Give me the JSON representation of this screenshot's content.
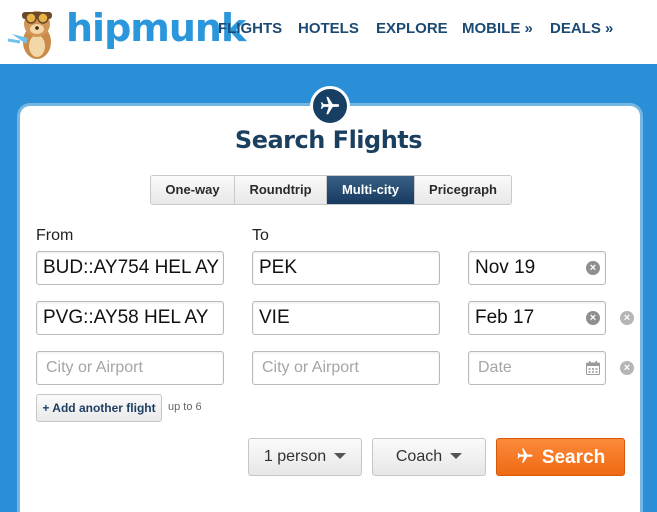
{
  "header": {
    "logo_text": "hipmunk",
    "nav": [
      "FLIGHTS",
      "HOTELS",
      "EXPLORE",
      "MOBILE »",
      "DEALS »"
    ]
  },
  "search": {
    "title": "Search Flights",
    "tabs": [
      {
        "label": "One-way",
        "active": false
      },
      {
        "label": "Roundtrip",
        "active": false
      },
      {
        "label": "Multi-city",
        "active": true
      },
      {
        "label": "Pricegraph",
        "active": false
      }
    ],
    "from_label": "From",
    "to_label": "To",
    "legs": [
      {
        "from": "BUD::AY754 HEL AY",
        "to": "PEK",
        "date": "Nov 19"
      },
      {
        "from": "PVG::AY58 HEL AY",
        "to": "VIE",
        "date": "Feb 17"
      }
    ],
    "empty_leg": {
      "from_placeholder": "City or Airport",
      "to_placeholder": "City or Airport",
      "date_placeholder": "Date"
    },
    "add_flight_label": "+ Add another flight",
    "add_flight_hint": "up to 6",
    "passengers": "1 person",
    "cabin": "Coach",
    "search_label": "Search"
  },
  "colors": {
    "brand_blue": "#2a96dc",
    "navy": "#173f64",
    "search_orange": "#f27420"
  }
}
